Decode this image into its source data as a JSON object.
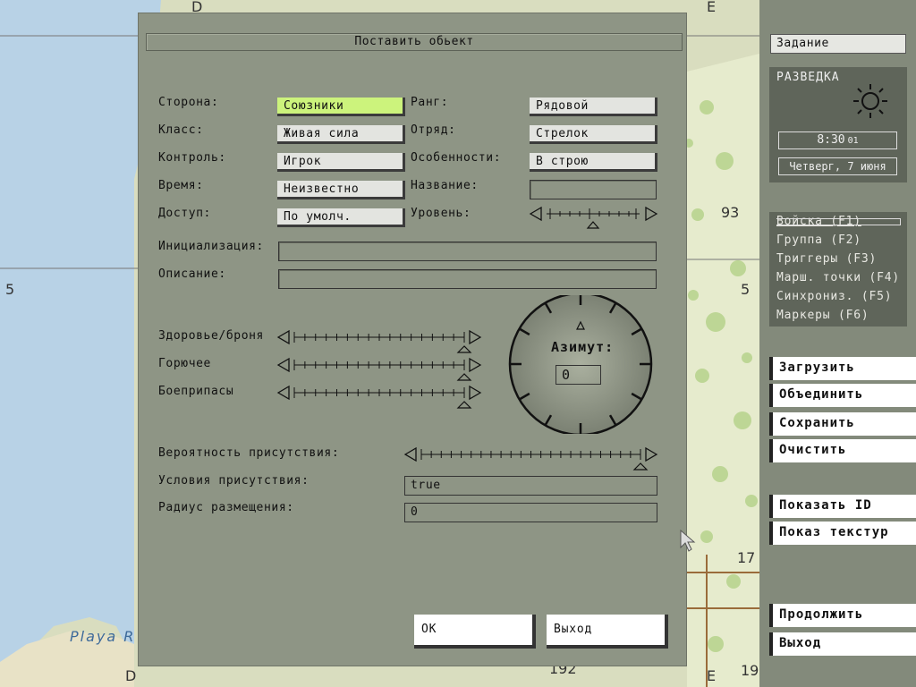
{
  "map": {
    "labels": [
      "D",
      "E",
      "5",
      "93",
      "5",
      "17",
      "192",
      "E",
      "19",
      "Playa R",
      "D"
    ]
  },
  "dialog": {
    "title": "Поставить обьект",
    "left_fields": [
      {
        "label": "Сторона:",
        "value": "Союзники"
      },
      {
        "label": "Класс:",
        "value": "Живая сила"
      },
      {
        "label": "Контроль:",
        "value": "Игрок"
      },
      {
        "label": "Время:",
        "value": "Неизвестно"
      },
      {
        "label": "Доступ:",
        "value": "По умолч."
      }
    ],
    "right_fields": [
      {
        "label": "Ранг:",
        "value": "Рядовой"
      },
      {
        "label": "Отряд:",
        "value": "Стрелок"
      },
      {
        "label": "Особенности:",
        "value": "В строю"
      },
      {
        "label": "Название:",
        "value": ""
      },
      {
        "label": "Уровень:",
        "value": ""
      }
    ],
    "init_label": "Инициализация:",
    "desc_label": "Описание:",
    "health_label": "Здоровье/броня",
    "fuel_label": "Горючее",
    "ammo_label": "Боеприпасы",
    "azimuth_label": "Азимут:",
    "azimuth_value": "0",
    "prob_label": "Вероятность присутствия:",
    "cond_label": "Условия присутствия:",
    "cond_value": "true",
    "radius_label": "Радиус размещения:",
    "radius_value": "0",
    "sliders": {
      "level": 0.5,
      "health": 1.0,
      "fuel": 1.0,
      "ammo": 1.0,
      "probability": 1.0
    },
    "ok_label": "OK",
    "exit_label": "Выход"
  },
  "panel": {
    "task_label": "Задание",
    "mission_title": "РАЗВЕДКА",
    "time_hm": "8:30",
    "time_s": "01",
    "date": "Четверг, 7 июня",
    "tabs": [
      "Войска (F1)",
      "Группа (F2)",
      "Триггеры (F3)",
      "Марш. точки (F4)",
      "Синхрониз. (F5)",
      "Маркеры (F6)"
    ],
    "buttons": [
      "Загрузить",
      "Объединить",
      "Сохранить",
      "Очистить",
      "Показать ID",
      "Показ текстур",
      "Продолжить",
      "Выход"
    ]
  },
  "colors": {
    "dialog_bg": "#8e9585",
    "selected_field": "#ccf37c",
    "water": "#b8d2e6",
    "land": "#d6dcb5"
  }
}
